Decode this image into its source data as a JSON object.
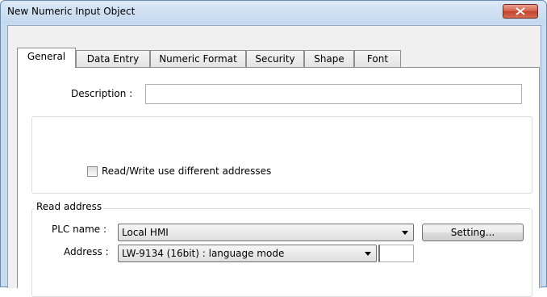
{
  "window": {
    "title": "New  Numeric Input Object",
    "close_icon": "close-x-icon"
  },
  "tabs": [
    {
      "label": "General",
      "active": true
    },
    {
      "label": "Data Entry",
      "active": false
    },
    {
      "label": "Numeric Format",
      "active": false
    },
    {
      "label": "Security",
      "active": false
    },
    {
      "label": "Shape",
      "active": false
    },
    {
      "label": "Font",
      "active": false
    }
  ],
  "general": {
    "description_label": "Description :",
    "description_value": "",
    "rw_checkbox_label": "Read/Write use different addresses",
    "rw_checkbox_checked": false,
    "read_address": {
      "group_label": "Read address",
      "plc_name_label": "PLC name :",
      "plc_name_value": "Local HMI",
      "setting_button": "Setting...",
      "address_label": "Address :",
      "address_value": "LW-9134 (16bit) : language mode",
      "address_extra_value": ""
    }
  }
}
